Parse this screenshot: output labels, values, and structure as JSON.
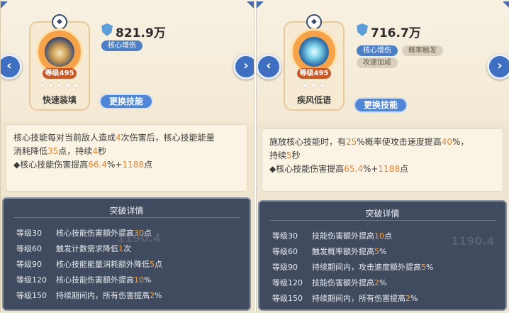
{
  "left": {
    "power": "821.9万",
    "tags": [
      "核心增伤"
    ],
    "skill_card": {
      "level": "等级495",
      "stars": "✦✦✦✦✦",
      "name": "快速装填"
    },
    "change_button": "更换技能",
    "desc": {
      "l1a": "核心技能每对当前敌人造成",
      "l1b": "4",
      "l1c": "次伤害后，核心技能能量",
      "l2a": "消耗降低",
      "l2b": "35",
      "l2c": "点，持续",
      "l2d": "4",
      "l2e": "秒",
      "l3a": "◆核心技能伤害提高",
      "l3b": "66.4",
      "l3c": "%+",
      "l3d": "1188",
      "l3e": "点"
    },
    "breakthrough": {
      "title": "突破详情",
      "ghost": "1190.4",
      "rows": [
        {
          "level": "等级30",
          "pre": "核心技能伤害额外提高",
          "val": "30",
          "post": "点"
        },
        {
          "level": "等级60",
          "pre": "触发计数需求降低",
          "val": "1",
          "post": "次"
        },
        {
          "level": "等级90",
          "pre": "核心技能能量消耗额外降低",
          "val": "5",
          "post": "点"
        },
        {
          "level": "等级120",
          "pre": "核心技能伤害额外提高",
          "val": "10",
          "post": "%"
        },
        {
          "level": "等级150",
          "pre": "持续期间内，所有伤害提高",
          "val": "2",
          "post": "%"
        }
      ]
    }
  },
  "right": {
    "power": "716.7万",
    "tags": [
      "核心增伤",
      "概率触发",
      "攻速加成"
    ],
    "skill_card": {
      "level": "等级495",
      "stars": "✦✦✦",
      "name": "疾风低语"
    },
    "change_button": "更换技能",
    "desc": {
      "l1a": "施放核心技能时，有",
      "l1b": "25",
      "l1c": "%概率使攻击速度提高",
      "l1d": "40",
      "l1e": "%，",
      "l2a": "持续",
      "l2b": "5",
      "l2c": "秒",
      "l3a": "◆核心技能伤害提高",
      "l3b": "65.4",
      "l3c": "%+",
      "l3d": "1188",
      "l3e": "点"
    },
    "breakthrough": {
      "title": "突破详情",
      "ghost": "1190.4",
      "rows": [
        {
          "level": "等级30",
          "pre": "技能伤害额外提高",
          "val": "10",
          "post": "点"
        },
        {
          "level": "等级60",
          "pre": "触发概率额外提高",
          "val": "5",
          "post": "%"
        },
        {
          "level": "等级90",
          "pre": "持续期间内，攻击速度额外提高",
          "val": "5",
          "post": "%"
        },
        {
          "level": "等级120",
          "pre": "技能伤害额外提高",
          "val": "2",
          "post": "%"
        },
        {
          "level": "等级150",
          "pre": "持续期间内，所有伤害提高",
          "val": "2",
          "post": "%"
        }
      ]
    }
  },
  "icons": {
    "prev": "chevron-left-icon",
    "next": "chevron-right-icon",
    "shield": "shield-icon",
    "gem": "diamond-icon"
  },
  "colors": {
    "accent_orange": "#e8842b",
    "button_blue": "#4f86d6",
    "dark_panel": "#414b5f",
    "tag_blue": "#4c7fc6"
  }
}
